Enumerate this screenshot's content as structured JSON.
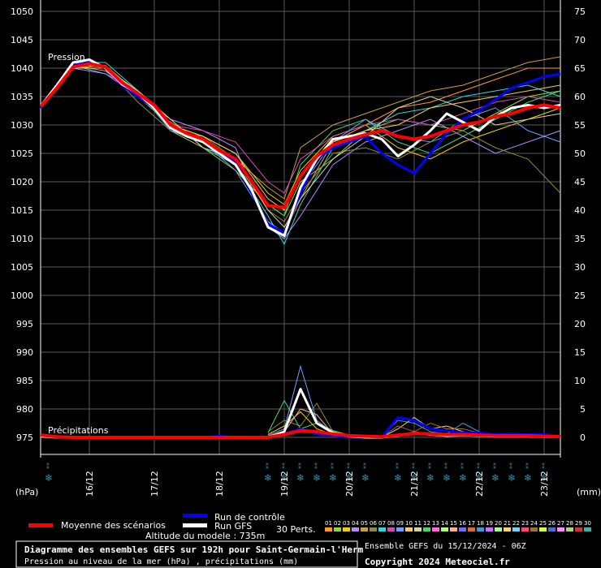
{
  "chart_data": {
    "type": "line",
    "title": "Diagramme des ensembles GEFS sur 192h pour Saint-Germain-l'Herm",
    "subtitle": "Pression au niveau de la mer (hPa) , précipitations (mm)",
    "altitude_text": "Altitude du modele : 735m",
    "run_text": "Ensemble GEFS du 15/12/2024 - 06Z",
    "copyright": "Copyright 2024 Meteociel.fr",
    "left_unit": "(hPa)",
    "right_unit": "(mm)",
    "pressure_label": "Pression",
    "precip_label": "Précipitations",
    "left_ticks": [
      1050,
      1045,
      1040,
      1035,
      1030,
      1025,
      1020,
      1015,
      1010,
      1005,
      1000,
      995,
      990,
      985,
      980,
      975
    ],
    "right_ticks": [
      75,
      70,
      65,
      60,
      55,
      50,
      45,
      40,
      35,
      30,
      25,
      20,
      15,
      10,
      5,
      0
    ],
    "x_ticks": [
      "16/12",
      "17/12",
      "18/12",
      "19/12",
      "20/12",
      "21/12",
      "22/12",
      "23/12"
    ],
    "x_range_hours": [
      0,
      192
    ],
    "ylim_pressure": [
      972,
      1052
    ],
    "ylim_precip": [
      -3,
      77
    ],
    "grid": true,
    "legend": {
      "mean": "Moyenne des scénarios",
      "control": "Run de contrôle",
      "gfs": "Run GFS",
      "perts_label": "30 Perts.",
      "pert_numbers": [
        "01",
        "02",
        "03",
        "04",
        "05",
        "06",
        "07",
        "08",
        "09",
        "10",
        "11",
        "12",
        "13",
        "14",
        "15",
        "16",
        "17",
        "18",
        "19",
        "20",
        "21",
        "22",
        "23",
        "24",
        "25",
        "26",
        "27",
        "28",
        "29",
        "30"
      ]
    },
    "colors": {
      "background": "#000000",
      "grid": "#5a5a5a",
      "mean": "#ff0000",
      "control": "#0000ff",
      "gfs": "#ffffff",
      "snow_symbol": "#2d8fb0",
      "perts": [
        "#ff9b2d",
        "#9bd43a",
        "#f0d010",
        "#b08cff",
        "#c8a040",
        "#8c8c3a",
        "#3ad4d4",
        "#d44ab0",
        "#6fa0ff",
        "#ffc864",
        "#d4d4a0",
        "#4ad46f",
        "#ff6fd4",
        "#b0ff6f",
        "#ffb09b",
        "#6f6fff",
        "#d46f3a",
        "#3a9bd4",
        "#c86fff",
        "#9bff9b",
        "#ffd46f",
        "#6fd4ff",
        "#ff4a6f",
        "#a06f3a",
        "#d4ff3a",
        "#4a6fd4",
        "#ff8cff",
        "#b0d46f",
        "#c83a3a",
        "#3ab0b0"
      ]
    },
    "series": [
      {
        "name": "Moyenne des scénarios",
        "role": "mean",
        "x": [
          0,
          6,
          12,
          18,
          24,
          30,
          36,
          42,
          48,
          54,
          60,
          66,
          72,
          78,
          84,
          90,
          96,
          102,
          108,
          114,
          120,
          126,
          132,
          138,
          144,
          150,
          156,
          162,
          168,
          174,
          180,
          186,
          192
        ],
        "values": [
          1033.2,
          1036.5,
          1040.2,
          1040.8,
          1040.2,
          1037.5,
          1035.5,
          1033.5,
          1030.0,
          1028.5,
          1027.5,
          1025.5,
          1024.0,
          1020.0,
          1015.8,
          1015.5,
          1021.0,
          1024.5,
          1026.5,
          1027.5,
          1028.3,
          1029.0,
          1028.0,
          1027.5,
          1028.0,
          1029.0,
          1030.0,
          1030.5,
          1031.5,
          1032.0,
          1033.0,
          1033.5,
          1033.0
        ]
      },
      {
        "name": "Run de contrôle",
        "role": "control",
        "x": [
          0,
          6,
          12,
          18,
          24,
          30,
          36,
          42,
          48,
          54,
          60,
          66,
          72,
          78,
          84,
          90,
          96,
          102,
          108,
          114,
          120,
          126,
          132,
          138,
          144,
          150,
          156,
          162,
          168,
          174,
          180,
          186,
          192
        ],
        "values": [
          1033.0,
          1036.8,
          1040.5,
          1041.0,
          1040.0,
          1037.0,
          1035.0,
          1033.0,
          1030.0,
          1028.5,
          1027.0,
          1025.0,
          1023.5,
          1018.0,
          1012.5,
          1011.0,
          1018.0,
          1024.0,
          1026.0,
          1027.0,
          1028.0,
          1025.0,
          1023.0,
          1021.5,
          1025.0,
          1028.5,
          1031.0,
          1032.5,
          1034.5,
          1036.5,
          1037.5,
          1038.5,
          1039.0
        ]
      },
      {
        "name": "Run GFS",
        "role": "gfs",
        "x": [
          0,
          6,
          12,
          18,
          24,
          30,
          36,
          42,
          48,
          54,
          60,
          66,
          72,
          78,
          84,
          90,
          96,
          102,
          108,
          114,
          120,
          126,
          132,
          138,
          144,
          150,
          156,
          162,
          168,
          174,
          180,
          186,
          192
        ],
        "values": [
          1033.3,
          1037.0,
          1041.0,
          1041.5,
          1040.0,
          1037.2,
          1035.5,
          1033.0,
          1029.5,
          1028.0,
          1027.0,
          1025.0,
          1023.0,
          1018.5,
          1012.0,
          1010.5,
          1019.0,
          1024.0,
          1027.5,
          1028.0,
          1028.5,
          1027.5,
          1024.5,
          1026.5,
          1029.0,
          1032.0,
          1030.5,
          1029.0,
          1031.5,
          1033.0,
          1033.5,
          1033.0,
          1033.5
        ]
      }
    ],
    "precip_series": [
      {
        "name": "Moyenne des scénarios",
        "role": "mean",
        "x": [
          0,
          6,
          12,
          18,
          24,
          30,
          36,
          42,
          48,
          54,
          60,
          66,
          72,
          78,
          84,
          90,
          96,
          102,
          108,
          114,
          120,
          126,
          132,
          138,
          144,
          150,
          156,
          162,
          168,
          174,
          180,
          186,
          192
        ],
        "values": [
          0.4,
          0.1,
          0,
          0,
          0,
          0,
          0,
          0,
          0,
          0,
          0,
          0,
          0,
          0,
          0,
          0.5,
          1.2,
          1.0,
          0.6,
          0.3,
          0.2,
          0.1,
          0.4,
          0.7,
          0.6,
          0.5,
          0.5,
          0.4,
          0.3,
          0.3,
          0.3,
          0.2,
          0.1
        ]
      },
      {
        "name": "Run de contrôle",
        "role": "control",
        "x": [
          0,
          6,
          12,
          18,
          24,
          30,
          36,
          42,
          48,
          54,
          60,
          66,
          72,
          78,
          84,
          90,
          96,
          102,
          108,
          114,
          120,
          126,
          132,
          138,
          144,
          150,
          156,
          162,
          168,
          174,
          180,
          186,
          192
        ],
        "values": [
          0.3,
          0,
          0,
          0,
          0,
          0,
          0,
          0,
          0,
          0,
          0,
          0.2,
          0,
          0,
          0,
          0.6,
          1.5,
          0.6,
          0.3,
          0,
          0,
          0,
          3.5,
          3.0,
          1.5,
          1.2,
          0.8,
          0.8,
          0.5,
          0.6,
          0.5,
          0.5,
          0.2
        ]
      },
      {
        "name": "Run GFS",
        "role": "gfs",
        "x": [
          0,
          6,
          12,
          18,
          24,
          30,
          36,
          42,
          48,
          54,
          60,
          66,
          72,
          78,
          84,
          90,
          96,
          102,
          108,
          114,
          120,
          126,
          132,
          138,
          144,
          150,
          156,
          162,
          168,
          174,
          180,
          186,
          192
        ],
        "values": [
          0.2,
          0,
          0,
          0,
          0,
          0,
          0,
          0,
          0,
          0,
          0,
          0,
          0,
          0,
          0,
          1.0,
          8.5,
          2.5,
          0.8,
          0.2,
          0,
          0,
          0.3,
          0.8,
          0.5,
          0.3,
          0.4,
          0.3,
          0.2,
          0.2,
          0.2,
          0.1,
          0.1
        ]
      }
    ],
    "snow_symbol_hours": [
      3,
      84,
      90,
      96,
      102,
      108,
      114,
      120,
      132,
      138,
      144,
      150,
      156,
      162,
      168,
      174,
      180,
      186
    ],
    "snow_symbol_text": "**",
    "sample_perturbations": [
      {
        "x": [
          0,
          12,
          24,
          36,
          48,
          60,
          72,
          84,
          90,
          96,
          108,
          120,
          132,
          144,
          156,
          168,
          180,
          192
        ],
        "values": [
          1033,
          1040.5,
          1039.5,
          1035,
          1030.5,
          1027,
          1023,
          1013,
          1011,
          1017,
          1027,
          1030,
          1033,
          1034,
          1036,
          1038,
          1040,
          1040
        ]
      },
      {
        "x": [
          0,
          12,
          24,
          36,
          48,
          60,
          72,
          84,
          90,
          96,
          108,
          120,
          132,
          144,
          156,
          168,
          180,
          192
        ],
        "values": [
          1033,
          1041,
          1040,
          1036,
          1029,
          1026,
          1022,
          1016,
          1014,
          1020,
          1024,
          1029,
          1031,
          1030,
          1029,
          1032,
          1035,
          1036
        ]
      },
      {
        "x": [
          0,
          12,
          24,
          36,
          48,
          60,
          72,
          84,
          90,
          96,
          108,
          120,
          132,
          144,
          156,
          168,
          180,
          192
        ],
        "values": [
          1033,
          1040,
          1040.5,
          1035.5,
          1030,
          1028,
          1025,
          1018,
          1016,
          1022,
          1028,
          1030,
          1026,
          1024,
          1027,
          1029,
          1031,
          1033
        ]
      },
      {
        "x": [
          0,
          12,
          24,
          36,
          48,
          60,
          72,
          84,
          90,
          96,
          108,
          120,
          132,
          144,
          156,
          168,
          180,
          192
        ],
        "values": [
          1033,
          1040,
          1039,
          1035,
          1031,
          1029,
          1026,
          1012,
          1010,
          1014,
          1023,
          1027,
          1029,
          1031,
          1028,
          1025,
          1027,
          1029
        ]
      },
      {
        "x": [
          0,
          12,
          24,
          36,
          48,
          60,
          72,
          84,
          90,
          96,
          108,
          120,
          132,
          144,
          156,
          168,
          180,
          192
        ],
        "values": [
          1033,
          1041,
          1040,
          1036,
          1030,
          1027,
          1024,
          1019,
          1017,
          1026,
          1030,
          1032,
          1034,
          1036,
          1037,
          1039,
          1041,
          1042
        ]
      },
      {
        "x": [
          0,
          12,
          24,
          36,
          48,
          60,
          72,
          84,
          90,
          96,
          108,
          120,
          132,
          144,
          156,
          168,
          180,
          192
        ],
        "values": [
          1033,
          1040,
          1040,
          1034,
          1029,
          1028,
          1024,
          1015,
          1013,
          1018,
          1025,
          1026,
          1024,
          1027,
          1029,
          1026,
          1024,
          1018
        ]
      },
      {
        "x": [
          0,
          12,
          24,
          36,
          48,
          60,
          72,
          84,
          90,
          96,
          108,
          120,
          132,
          144,
          156,
          168,
          180,
          192
        ],
        "values": [
          1033,
          1041,
          1041,
          1036,
          1031,
          1026,
          1023,
          1014,
          1009,
          1016,
          1026,
          1029,
          1032,
          1033,
          1035,
          1036,
          1037,
          1035
        ]
      },
      {
        "x": [
          0,
          12,
          24,
          36,
          48,
          60,
          72,
          84,
          90,
          96,
          108,
          120,
          132,
          144,
          156,
          168,
          180,
          192
        ],
        "values": [
          1033,
          1040,
          1040,
          1035,
          1030,
          1029,
          1027,
          1020,
          1018,
          1024,
          1028,
          1030,
          1031,
          1030,
          1032,
          1034,
          1035,
          1034
        ]
      },
      {
        "x": [
          0,
          12,
          24,
          36,
          48,
          60,
          72,
          84,
          90,
          96,
          108,
          120,
          132,
          144,
          156,
          168,
          180,
          192
        ],
        "values": [
          1033,
          1040.5,
          1039,
          1036,
          1029,
          1027,
          1022,
          1013,
          1011,
          1019,
          1027,
          1031,
          1028,
          1027,
          1031,
          1033,
          1029,
          1027
        ]
      },
      {
        "x": [
          0,
          12,
          24,
          36,
          48,
          60,
          72,
          84,
          90,
          96,
          108,
          120,
          132,
          144,
          156,
          168,
          180,
          192
        ],
        "values": [
          1033,
          1041,
          1040,
          1035,
          1030,
          1028,
          1025,
          1017,
          1015,
          1021,
          1027,
          1029,
          1030,
          1033,
          1034,
          1035,
          1036,
          1037
        ]
      },
      {
        "x": [
          0,
          12,
          24,
          36,
          48,
          60,
          72,
          84,
          90,
          96,
          108,
          120,
          132,
          144,
          156,
          168,
          180,
          192
        ],
        "values": [
          1033,
          1040,
          1040,
          1036,
          1031,
          1026,
          1024,
          1015,
          1012,
          1017,
          1024,
          1028,
          1033,
          1035,
          1033,
          1030,
          1031,
          1032
        ]
      },
      {
        "x": [
          0,
          12,
          24,
          36,
          48,
          60,
          72,
          84,
          90,
          96,
          108,
          120,
          132,
          144,
          156,
          168,
          180,
          192
        ],
        "values": [
          1033,
          1041,
          1040.5,
          1035,
          1030,
          1027,
          1023,
          1016,
          1014,
          1023,
          1029,
          1031,
          1027,
          1025,
          1028,
          1031,
          1034,
          1036
        ]
      }
    ],
    "sample_perturbation_precip": [
      {
        "x": [
          84,
          90,
          96,
          102,
          108,
          114,
          120
        ],
        "values": [
          0.5,
          2.0,
          4.5,
          1.5,
          0.5,
          0.2,
          0
        ]
      },
      {
        "x": [
          84,
          90,
          96,
          102,
          108,
          114,
          120
        ],
        "values": [
          1.0,
          3.0,
          2.0,
          6.0,
          1.0,
          0.3,
          0
        ]
      },
      {
        "x": [
          84,
          90,
          96,
          102,
          108,
          114,
          120
        ],
        "values": [
          0.3,
          1.5,
          12.5,
          3.0,
          0.8,
          0.2,
          0
        ]
      },
      {
        "x": [
          84,
          90,
          96,
          102,
          108,
          114,
          120
        ],
        "values": [
          0.8,
          6.5,
          1.5,
          2.5,
          1.2,
          0.4,
          0
        ]
      },
      {
        "x": [
          84,
          90,
          96,
          102,
          108,
          114,
          120
        ],
        "values": [
          0.2,
          1.0,
          5.0,
          4.0,
          0.6,
          0.3,
          0.1
        ]
      },
      {
        "x": [
          126,
          132,
          138,
          144,
          150,
          156,
          162
        ],
        "values": [
          0.2,
          3.0,
          2.5,
          1.0,
          0.6,
          2.5,
          1.0
        ]
      },
      {
        "x": [
          126,
          132,
          138,
          144,
          150,
          156,
          162
        ],
        "values": [
          0,
          1.5,
          3.5,
          1.5,
          2.0,
          1.0,
          0.5
        ]
      },
      {
        "x": [
          126,
          132,
          138,
          144,
          150,
          156,
          162
        ],
        "values": [
          0.1,
          2.0,
          1.0,
          2.5,
          1.5,
          1.5,
          0.8
        ]
      }
    ]
  }
}
